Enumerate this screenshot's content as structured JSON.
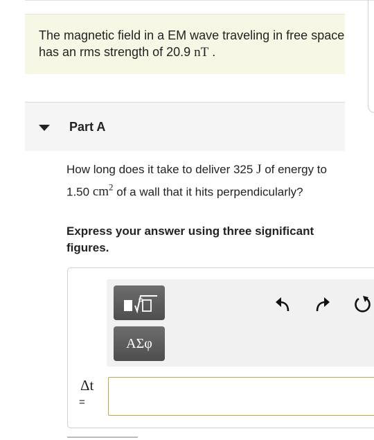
{
  "problem": {
    "text": "The magnetic field in a EM wave traveling in free space has an rms strength of 20.9",
    "unit": "nT",
    "end": "."
  },
  "part": {
    "title": "Part A",
    "question_pre": "How long does it take to deliver 325",
    "q_unit1": "J",
    "question_mid": "of energy to 1.50",
    "q_unit2": "cm",
    "q_exp": "2",
    "question_post": "of a wall that it hits perpendicularly?",
    "instruction": "Express your answer using three significant figures."
  },
  "toolbar": {
    "templates_icon": "templates-icon",
    "symbols_label": "ΑΣφ",
    "undo_icon": "undo-icon",
    "redo_icon": "redo-icon",
    "reset_icon": "reset-icon"
  },
  "answer": {
    "variable": "Δt",
    "equals": "=",
    "value": ""
  },
  "colors": {
    "prompt_bg": "#f7f7e6",
    "part_bg": "#f5f5f5",
    "button_bg": "#5a5a5a",
    "input_border": "#b9a94a"
  }
}
